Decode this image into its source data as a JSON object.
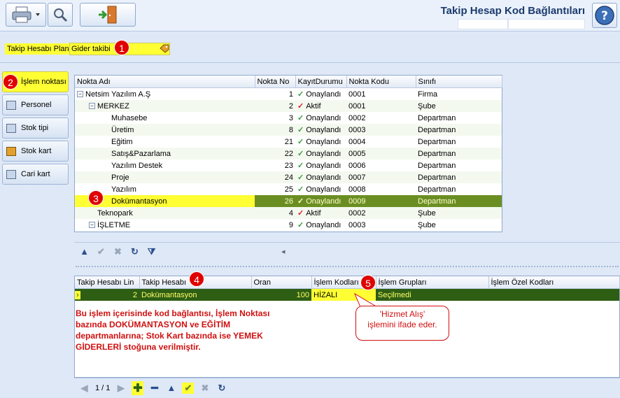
{
  "window": {
    "title": "Takip Hesap Kod Bağlantıları"
  },
  "toolbar": {
    "print_icon": "printer-icon",
    "search_icon": "magnifier-wrench-icon",
    "exit_icon": "exit-door-icon",
    "help_icon": "help-icon"
  },
  "plan": {
    "label": "Takip Hesabı Planı",
    "value": "Gider takibi"
  },
  "markers": [
    "1",
    "2",
    "3",
    "4",
    "5"
  ],
  "side_tabs": [
    {
      "label": "İşlem noktası",
      "active": true
    },
    {
      "label": "Personel",
      "active": false
    },
    {
      "label": "Stok tipi",
      "active": false
    },
    {
      "label": "Stok kart",
      "active": false
    },
    {
      "label": "Cari kart",
      "active": false
    }
  ],
  "tree": {
    "columns": [
      "Nokta Adı",
      "Nokta No",
      "KayıtDurumu",
      "Nokta Kodu",
      "Sınıfı"
    ],
    "rows": [
      {
        "name": "Netsim Yazılım A.Ş",
        "no": "1",
        "status": "Onaylandı",
        "code": "0001",
        "cls": "Firma"
      },
      {
        "name": "MERKEZ",
        "no": "2",
        "status": "Aktif",
        "code": "0001",
        "cls": "Şube"
      },
      {
        "name": "Muhasebe",
        "no": "3",
        "status": "Onaylandı",
        "code": "0002",
        "cls": "Departman"
      },
      {
        "name": "Üretim",
        "no": "8",
        "status": "Onaylandı",
        "code": "0003",
        "cls": "Departman"
      },
      {
        "name": "Eğitim",
        "no": "21",
        "status": "Onaylandı",
        "code": "0004",
        "cls": "Departman"
      },
      {
        "name": "Satış&Pazarlama",
        "no": "22",
        "status": "Onaylandı",
        "code": "0005",
        "cls": "Departman"
      },
      {
        "name": "Yazılım Destek",
        "no": "23",
        "status": "Onaylandı",
        "code": "0006",
        "cls": "Departman"
      },
      {
        "name": "Proje",
        "no": "24",
        "status": "Onaylandı",
        "code": "0007",
        "cls": "Departman"
      },
      {
        "name": "Yazılım",
        "no": "25",
        "status": "Onaylandı",
        "code": "0008",
        "cls": "Departman"
      },
      {
        "name": "Dokümantasyon",
        "no": "26",
        "status": "Onaylandı",
        "code": "0009",
        "cls": "Departman"
      },
      {
        "name": "Teknopark",
        "no": "4",
        "status": "Aktif",
        "code": "0002",
        "cls": "Şube"
      },
      {
        "name": "İŞLETME",
        "no": "9",
        "status": "Onaylandı",
        "code": "0003",
        "cls": "Şube"
      }
    ]
  },
  "detail": {
    "columns": [
      "Takip Hesabı Lin",
      "Takip Hesabı",
      "Oran",
      "İşlem Kodları",
      "İşlem Grupları",
      "İşlem Özel Kodları"
    ],
    "row": {
      "link": "2",
      "account": "Dokümantasyon",
      "ratio": "100",
      "codes": "HİZALI",
      "groups": "Seçilmedi",
      "special": ""
    }
  },
  "pager": {
    "text": "1 / 1"
  },
  "annotation": {
    "note_lines": [
      "Bu işlem içerisinde kod bağlantısı, İşlem Noktası",
      "bazında DOKÜMANTASYON ve EĞİTİM",
      "departmanlarına; Stok Kart bazında ise YEMEK",
      "GİDERLERİ stoğuna verilmiştir."
    ],
    "callout_lines": [
      "'Hizmet Alış'",
      "işlemini ifade eder."
    ]
  }
}
